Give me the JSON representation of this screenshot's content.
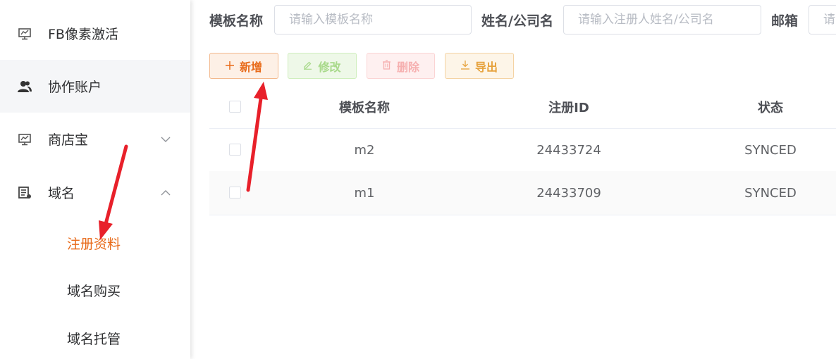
{
  "sidebar": {
    "items": [
      {
        "label": "FB像素激活",
        "icon": "monitor-chart-icon"
      },
      {
        "label": "协作账户",
        "icon": "users-icon"
      },
      {
        "label": "商店宝",
        "icon": "monitor-chart-icon",
        "expanded": false
      },
      {
        "label": "域名",
        "icon": "server-icon",
        "expanded": true
      }
    ],
    "subitems": [
      {
        "label": "注册资料",
        "active": true
      },
      {
        "label": "域名购买",
        "active": false
      },
      {
        "label": "域名托管",
        "active": false
      }
    ]
  },
  "filters": {
    "template_label": "模板名称",
    "template_placeholder": "请输入模板名称",
    "name_label": "姓名/公司名",
    "name_placeholder": "请输入注册人姓名/公司名",
    "email_label": "邮箱",
    "email_placeholder": "请"
  },
  "toolbar": {
    "add_label": "新增",
    "edit_label": "修改",
    "delete_label": "删除",
    "export_label": "导出"
  },
  "table": {
    "columns": [
      "模板名称",
      "注册ID",
      "状态"
    ],
    "rows": [
      {
        "name": "m2",
        "id": "24433724",
        "status": "SYNCED"
      },
      {
        "name": "m1",
        "id": "24433709",
        "status": "SYNCED"
      }
    ]
  },
  "colors": {
    "accent": "#e86a19",
    "annotation_arrow": "#e8202a"
  }
}
